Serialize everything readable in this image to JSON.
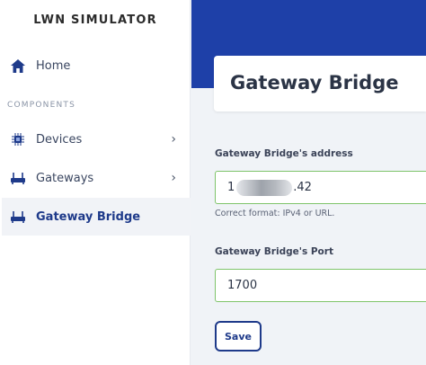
{
  "sidebar": {
    "brand": "LWN SIMULATOR",
    "home_label": "Home",
    "section_label": "COMPONENTS",
    "items": [
      {
        "label": "Devices",
        "icon": "chip-icon"
      },
      {
        "label": "Gateways",
        "icon": "router-icon"
      },
      {
        "label": "Gateway Bridge",
        "icon": "router-icon",
        "active": true
      }
    ]
  },
  "main": {
    "title": "Gateway Bridge",
    "address_label": "Gateway Bridge's address",
    "address_value_prefix": "1",
    "address_value_suffix": ".42",
    "address_hint": "Correct format: IPv4 or URL.",
    "port_label": "Gateway Bridge's Port",
    "port_value": "1700",
    "save_label": "Save"
  },
  "colors": {
    "banner": "#1e40a8",
    "accent": "#1e3a8a",
    "valid_border": "#7fc46a"
  }
}
